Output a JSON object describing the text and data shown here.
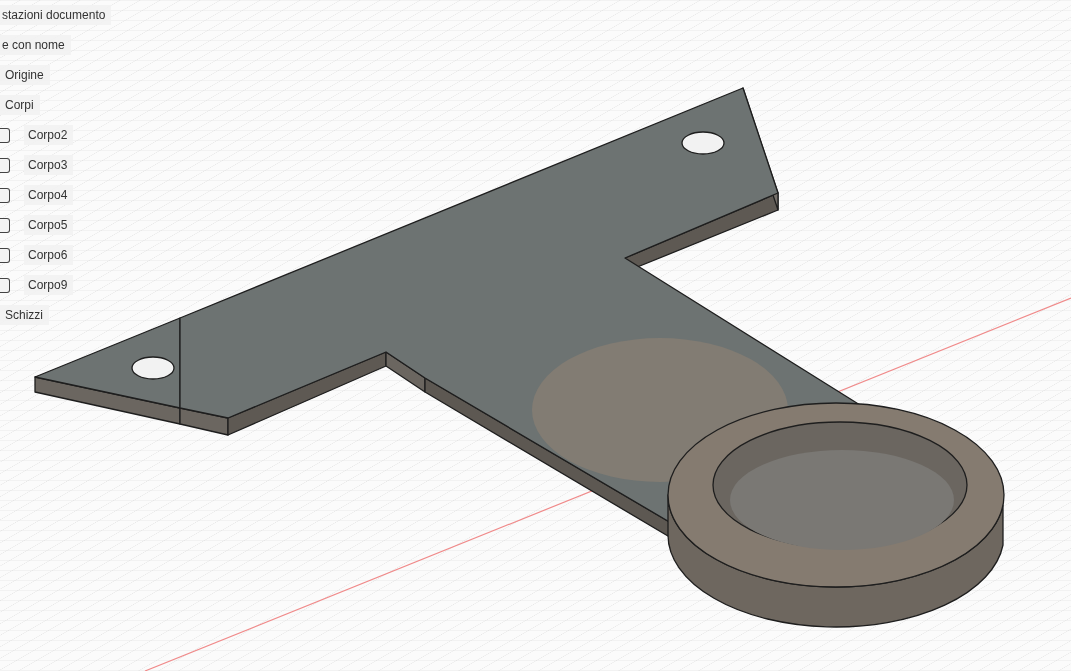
{
  "browser": {
    "items": [
      {
        "label": "stazioni documento"
      },
      {
        "label": "e con nome"
      },
      {
        "label": "Origine"
      },
      {
        "label": "Corpi",
        "children": [
          {
            "label": "Corpo2"
          },
          {
            "label": "Corpo3"
          },
          {
            "label": "Corpo4"
          },
          {
            "label": "Corpo5"
          },
          {
            "label": "Corpo6"
          },
          {
            "label": "Corpo9"
          }
        ]
      },
      {
        "label": "Schizzi"
      }
    ]
  }
}
